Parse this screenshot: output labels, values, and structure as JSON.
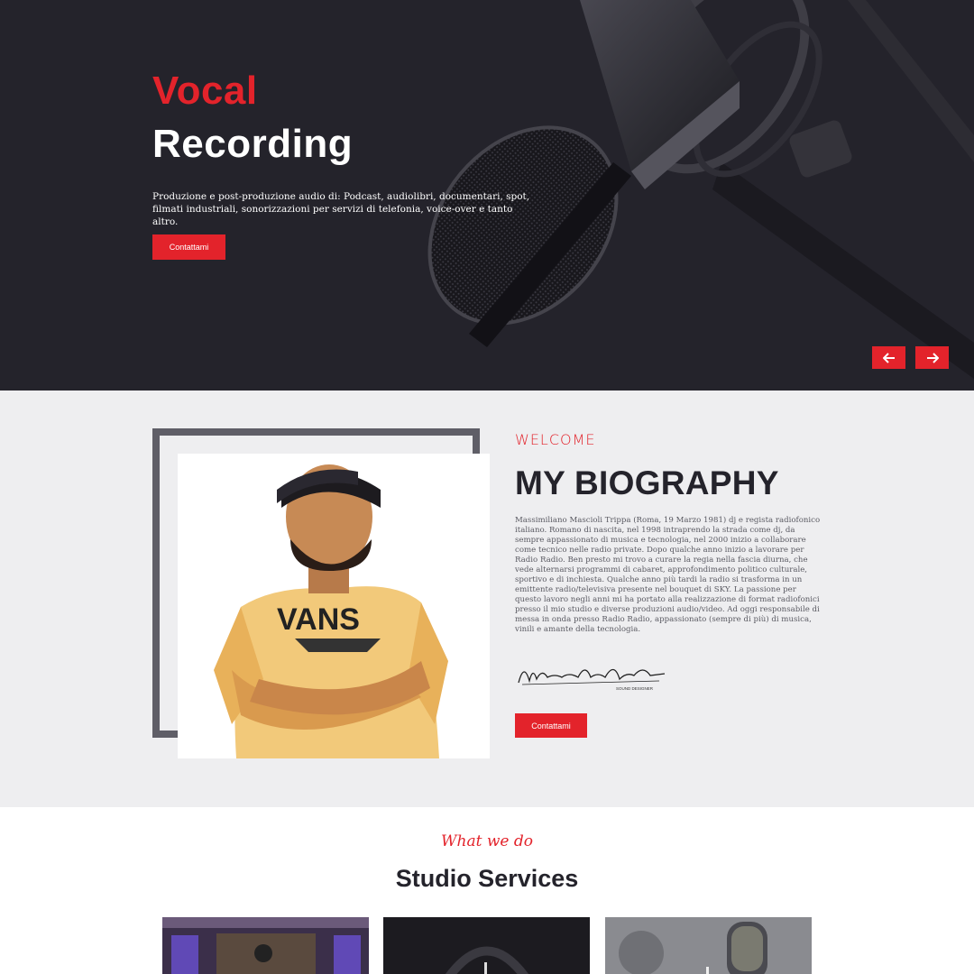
{
  "hero": {
    "title_line1": "Vocal",
    "title_line2": "Recording",
    "description": "Produzione e post-produzione audio di: Podcast, audiolibri, documentari, spot, filmati industriali, sonorizzazioni per servizi di telefonia, voice-over e tanto altro.",
    "cta_label": "Contattami",
    "prev_icon": "arrow-left-icon",
    "next_icon": "arrow-right-icon"
  },
  "bio": {
    "eyebrow": "WELCOME",
    "title": "MY BIOGRAPHY",
    "text": "Massimiliano Mascioli Trippa (Roma, 19 Marzo 1981) dj e regista radiofonico italiano. Romano di nascita, nel 1998 intraprendo la strada come dj, da sempre appassionato di musica e tecnologia, nel 2000 inizio a collaborare come tecnico nelle radio private. Dopo qualche anno inizio a lavorare per Radio Radio. Ben presto mi trovo a curare la regia nella fascia diurna, che vede alternarsi programmi di cabaret, approfondimento politico culturale, sportivo e di inchiesta. Qualche anno più tardi la radio si trasforma in un emittente radio/televisiva presente nel bouquet di SKY. La passione per questo lavoro negli anni mi ha portato alla realizzazione di format radiofonici presso il mio studio e diverse produzioni audio/video. Ad oggi responsabile di messa in onda presso Radio Radio, appassionato (sempre di più) di musica, vinili e amante della tecnologia.",
    "signature_name": "Massimiliano Mascioli Trippa",
    "signature_sub": "SOUND DESIGNER",
    "cta_label": "Contattami"
  },
  "services": {
    "eyebrow": "What we do",
    "title": "Studio Services"
  },
  "colors": {
    "accent": "#e3232b",
    "dark": "#24232b",
    "bio_bg": "#eeeef0",
    "frame": "#5f5e67"
  }
}
